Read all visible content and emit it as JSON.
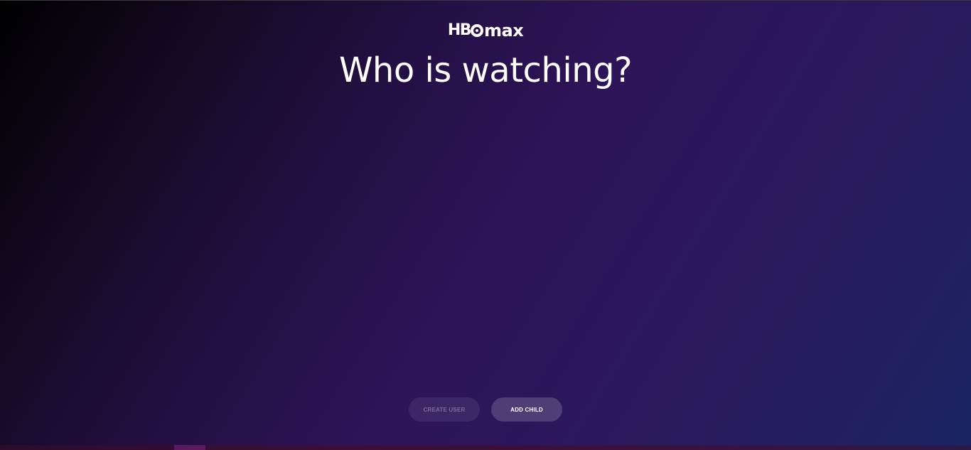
{
  "brand": {
    "logo_hbo": "HB",
    "logo_max": "max",
    "logo_alt": "HBOmax"
  },
  "heading": {
    "title": "Who is watching?"
  },
  "actions": {
    "create_user_label": "CREATE USER",
    "add_child_label": "ADD CHILD"
  },
  "colors": {
    "background_start": "#000000",
    "background_mid": "#2e1458",
    "background_end": "#1b2463",
    "text": "#ffffff"
  }
}
